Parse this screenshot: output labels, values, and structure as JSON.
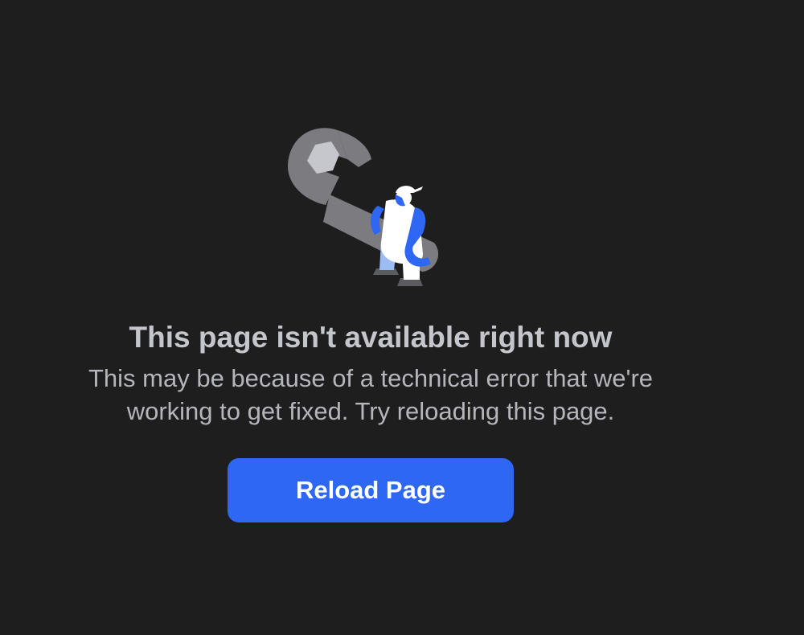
{
  "illustration": {
    "icon": "wrench-worker-illustration",
    "colors": {
      "wrench": "#7c7c80",
      "nut": "#c5c7cc",
      "worker_accent": "#2d67f3",
      "worker_body": "#ffffff",
      "worker_light": "#9cbcf4",
      "shadow": "#5a5c60"
    }
  },
  "error": {
    "title": "This page isn't available right now",
    "message_line1": "This may be because of a technical error that we're",
    "message_line2": "working to get fixed. Try reloading this page."
  },
  "actions": {
    "reload_label": "Reload Page"
  },
  "colors": {
    "background": "#1e1e1f",
    "title": "#c4c6cb",
    "message": "#b4b6bb",
    "button": "#2d67f3",
    "button_text": "#ffffff"
  }
}
